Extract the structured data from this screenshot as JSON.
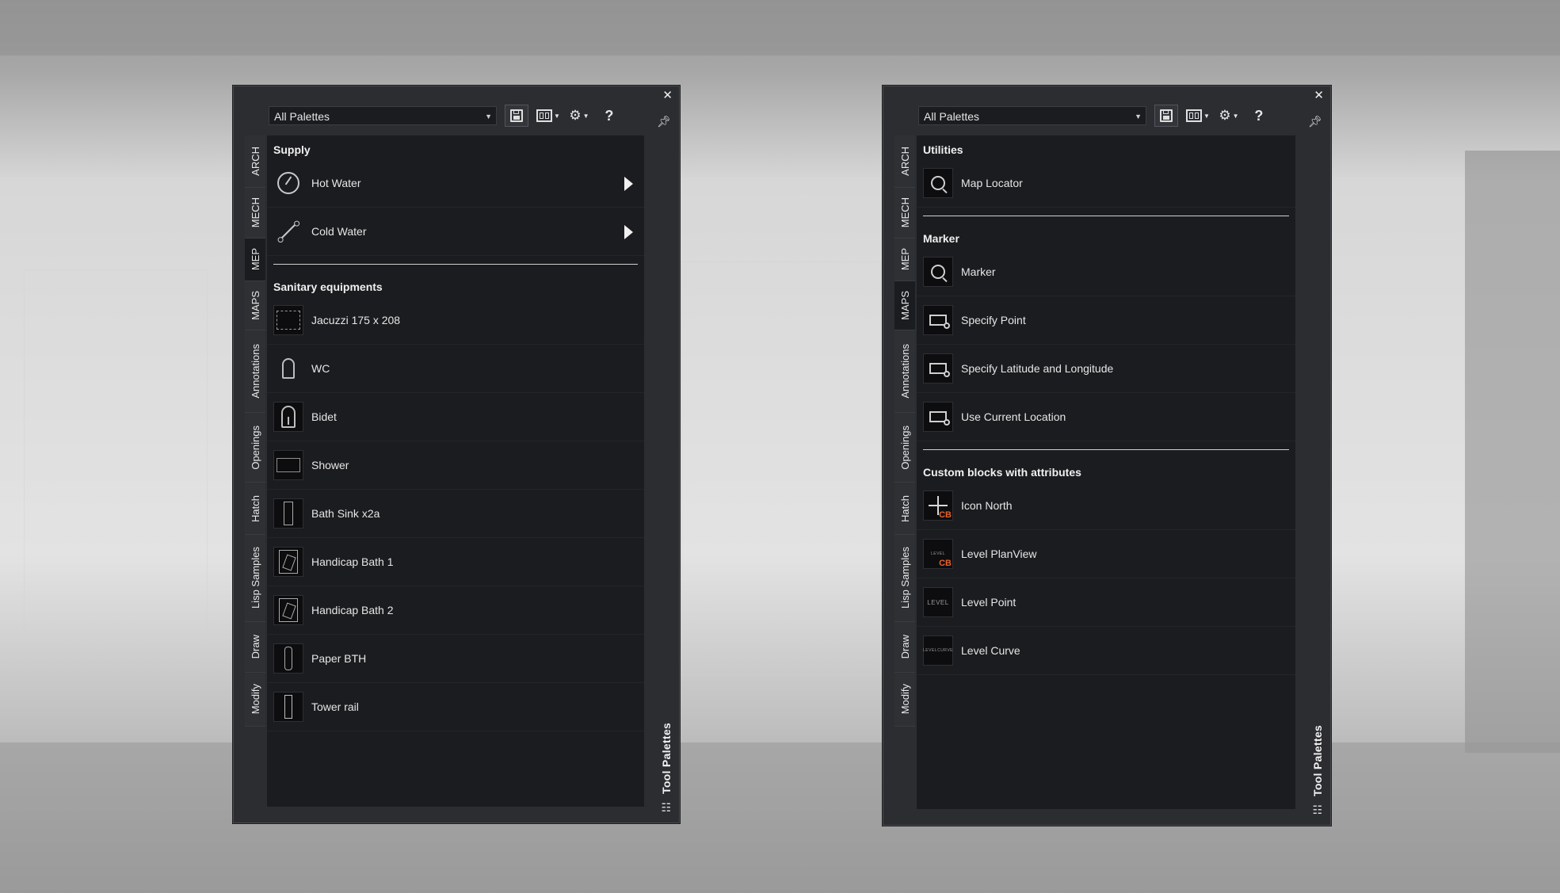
{
  "left_palette": {
    "selector_value": "All Palettes",
    "title": "Tool Palettes",
    "tabs": [
      "ARCH",
      "MECH",
      "MEP",
      "MAPS",
      "Annotations",
      "Openings",
      "Hatch",
      "Lisp Samples",
      "Draw",
      "Modify"
    ],
    "sections": {
      "supply": {
        "title": "Supply",
        "tools": [
          "Hot Water",
          "Cold Water"
        ]
      },
      "sanitary": {
        "title": "Sanitary equipments",
        "tools": [
          "Jacuzzi 175 x 208",
          "WC",
          "Bidet",
          "Shower",
          "Bath Sink x2a",
          "Handicap Bath 1",
          "Handicap Bath 2",
          "Paper BTH",
          "Tower rail"
        ]
      }
    }
  },
  "right_palette": {
    "selector_value": "All Palettes",
    "title": "Tool Palettes",
    "tabs": [
      "ARCH",
      "MECH",
      "MEP",
      "MAPS",
      "Annotations",
      "Openings",
      "Hatch",
      "Lisp Samples",
      "Draw",
      "Modify"
    ],
    "sections": {
      "utilities": {
        "title": "Utilities",
        "tools": [
          "Map Locator"
        ]
      },
      "marker": {
        "title": "Marker",
        "tools": [
          "Marker",
          "Specify Point",
          "Specify Latitude and Longitude",
          "Use Current Location"
        ]
      },
      "custom": {
        "title": "Custom blocks with attributes",
        "tools": [
          "Icon North",
          "Level PlanView",
          "Level Point",
          "Level Curve"
        ]
      }
    }
  },
  "icons": {
    "close": "close-icon",
    "pin": "pin-icon",
    "save": "save-icon",
    "view": "view-options-icon",
    "settings": "gear-icon",
    "help": "help-icon",
    "properties": "properties-icon",
    "cb_badge_text": "CB",
    "level_badge_text": "LEVEL",
    "levelcurve_badge_text": "LEVELCURVE"
  },
  "colors": {
    "panel": "#2c2d31",
    "content": "#1b1c1f",
    "accent_cb": "#e8612c"
  }
}
